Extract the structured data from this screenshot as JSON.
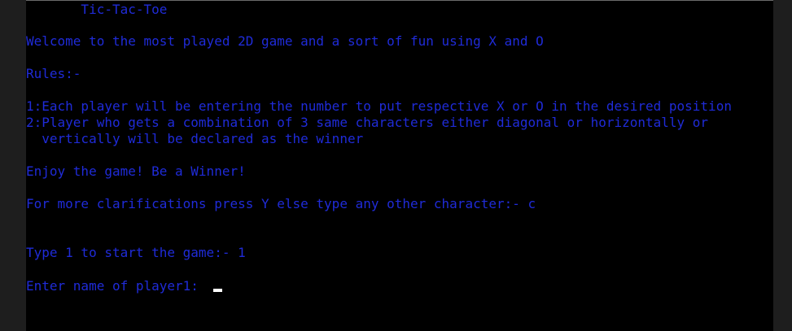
{
  "console": {
    "title_line": "       Tic-Tac-Toe",
    "welcome": "Welcome to the most played 2D game and a sort of fun using X and O",
    "rules_heading": "Rules:-",
    "rule1": "1:Each player will be entering the number to put respective X or O in the desired position",
    "rule2_line1": "2:Player who gets a combination of 3 same characters either diagonal or horizontally or",
    "rule2_line2": "  vertically will be declared as the winner",
    "enjoy": "Enjoy the game! Be a Winner!",
    "clarify_prompt": "For more clarifications press Y else type any other character:- c",
    "start_prompt": "Type 1 to start the game:- 1",
    "player1_prompt": "Enter name of player1: "
  },
  "colors": {
    "text": "#1f2bd8",
    "background": "#000000",
    "cursor": "#ffffff"
  }
}
